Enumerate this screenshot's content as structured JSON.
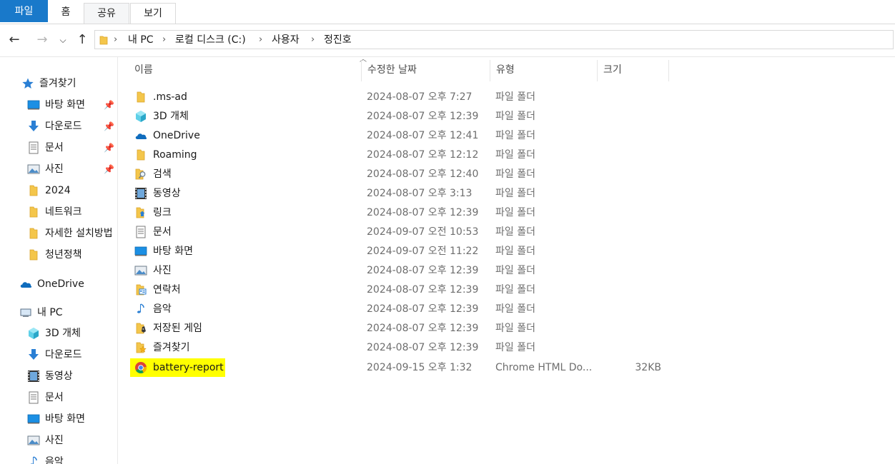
{
  "ribbon": {
    "file": "파일",
    "home": "홈",
    "share": "공유",
    "view": "보기"
  },
  "nav": {
    "back_icon": "left-arrow-icon",
    "forward_icon": "right-arrow-icon",
    "recent_icon": "chevron-down-icon",
    "up_icon": "up-arrow-icon",
    "breadcrumb": [
      "내 PC",
      "로컬 디스크 (C:)",
      "사용자",
      "정진호"
    ]
  },
  "sidebar": {
    "quick_access": "즐겨찾기",
    "quick_items": [
      "바탕 화면",
      "다운로드",
      "문서",
      "사진",
      "2024",
      "네트워크",
      "자세한 설치방법",
      "청년정책"
    ],
    "onedrive": "OneDrive",
    "this_pc": "내 PC",
    "pc_items": [
      "3D 개체",
      "다운로드",
      "동영상",
      "문서",
      "바탕 화면",
      "사진",
      "음악"
    ]
  },
  "columns": {
    "name": "이름",
    "date": "수정한 날짜",
    "type": "유형",
    "size": "크기"
  },
  "files": [
    {
      "name": ".ms-ad",
      "date": "2024-08-07 오후 7:27",
      "type": "파일 폴더",
      "size": "",
      "icon": "folder-icon"
    },
    {
      "name": "3D 개체",
      "date": "2024-08-07 오후 12:39",
      "type": "파일 폴더",
      "size": "",
      "icon": "3d-objects-icon"
    },
    {
      "name": "OneDrive",
      "date": "2024-08-07 오후 12:41",
      "type": "파일 폴더",
      "size": "",
      "icon": "onedrive-cloud-icon"
    },
    {
      "name": "Roaming",
      "date": "2024-08-07 오후 12:12",
      "type": "파일 폴더",
      "size": "",
      "icon": "folder-icon"
    },
    {
      "name": "검색",
      "date": "2024-08-07 오후 12:40",
      "type": "파일 폴더",
      "size": "",
      "icon": "search-folder-icon"
    },
    {
      "name": "동영상",
      "date": "2024-08-07 오후 3:13",
      "type": "파일 폴더",
      "size": "",
      "icon": "videos-icon"
    },
    {
      "name": "링크",
      "date": "2024-08-07 오후 12:39",
      "type": "파일 폴더",
      "size": "",
      "icon": "links-icon"
    },
    {
      "name": "문서",
      "date": "2024-09-07 오전 10:53",
      "type": "파일 폴더",
      "size": "",
      "icon": "documents-icon"
    },
    {
      "name": "바탕 화면",
      "date": "2024-09-07 오전 11:22",
      "type": "파일 폴더",
      "size": "",
      "icon": "desktop-icon"
    },
    {
      "name": "사진",
      "date": "2024-08-07 오후 12:39",
      "type": "파일 폴더",
      "size": "",
      "icon": "pictures-icon"
    },
    {
      "name": "연락처",
      "date": "2024-08-07 오후 12:39",
      "type": "파일 폴더",
      "size": "",
      "icon": "contacts-icon"
    },
    {
      "name": "음악",
      "date": "2024-08-07 오후 12:39",
      "type": "파일 폴더",
      "size": "",
      "icon": "music-icon"
    },
    {
      "name": "저장된 게임",
      "date": "2024-08-07 오후 12:39",
      "type": "파일 폴더",
      "size": "",
      "icon": "saved-games-icon"
    },
    {
      "name": "즐겨찾기",
      "date": "2024-08-07 오후 12:39",
      "type": "파일 폴더",
      "size": "",
      "icon": "favorites-icon"
    },
    {
      "name": "battery-report",
      "date": "2024-09-15 오후 1:32",
      "type": "Chrome HTML Do...",
      "size": "32KB",
      "icon": "chrome-icon"
    }
  ],
  "colors": {
    "file_tab": "#1979ca",
    "highlight": "#ffff00",
    "folder": "#f4c64b"
  }
}
